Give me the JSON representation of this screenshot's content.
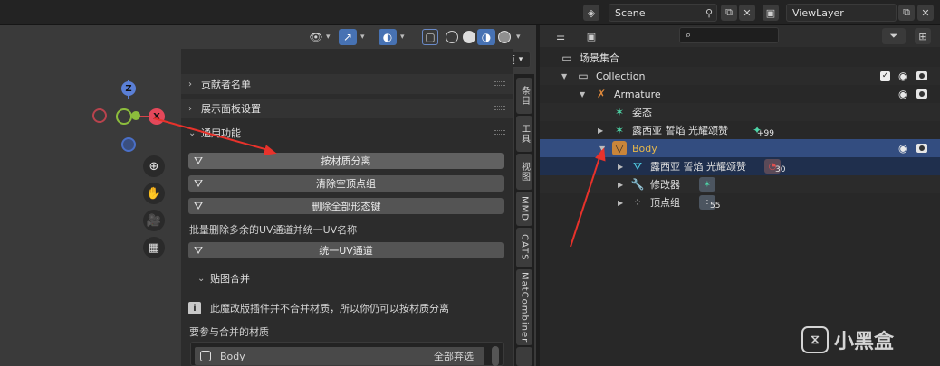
{
  "top": {
    "scene_label": "Scene",
    "viewlayer_label": "ViewLayer"
  },
  "viewport": {
    "options_label": "选项",
    "gizmo": {
      "z": "Z",
      "x": "X"
    }
  },
  "npanel": {
    "sections": [
      {
        "label": "贡献者名单"
      },
      {
        "label": "展示面板设置"
      },
      {
        "label": "通用功能"
      }
    ],
    "buttons": [
      {
        "label": "按材质分离"
      },
      {
        "label": "清除空顶点组"
      },
      {
        "label": "删除全部形态键"
      }
    ],
    "uv_description": "批量删除多余的UV通道并统一UV名称",
    "uv_button": "统一UV通道",
    "texture_merge_label": "贴图合并",
    "info_text": "此魔改版插件并不合并材质，所以你仍可以按材质分离",
    "materials_label": "要参与合并的材质",
    "material_row": {
      "name": "Body",
      "action": "全部弃选"
    }
  },
  "vtabs": [
    "条目",
    "工具",
    "视图",
    "MMD",
    "CATS",
    "MatCombiner"
  ],
  "outliner": {
    "search_placeholder": "",
    "root_label": "场景集合",
    "rows": [
      {
        "label": "Collection"
      },
      {
        "label": "Armature"
      },
      {
        "label": "姿态"
      },
      {
        "label": "露西亚 誓焰 光耀颂赞",
        "badge": "+99"
      },
      {
        "label": "Body"
      },
      {
        "label": "露西亚 誓焰 光耀颂赞",
        "badge": "30"
      },
      {
        "label": "修改器"
      },
      {
        "label": "顶点组",
        "badge": "55"
      }
    ]
  },
  "watermark": {
    "text": "小黑盒"
  },
  "colors": {
    "accent_blue": "#4772b3",
    "highlight_row": "#334d80",
    "annotation_red": "#e8322b",
    "body_label": "#e8b84a"
  }
}
